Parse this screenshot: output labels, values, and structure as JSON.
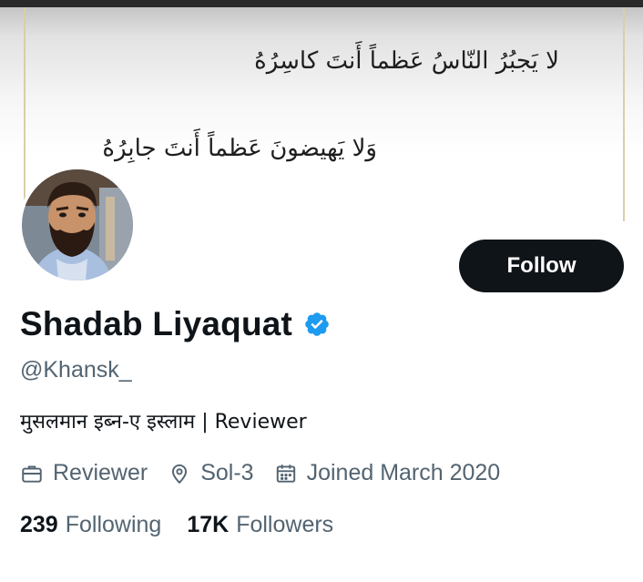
{
  "banner": {
    "verse_line_1": "لا يَجبُرُ النّاسُ عَظماً أَنتَ كاسِرُهُ",
    "verse_line_2": "وَلا يَهيضونَ عَظماً أَنتَ جابِرُهُ"
  },
  "profile": {
    "display_name": "Shadab Liyaquat",
    "handle": "@Khansk_",
    "bio": "मुसलमान इब्न-ए इस्लाम | Reviewer",
    "verified": true,
    "follow_label": "Follow"
  },
  "meta": {
    "profession": "Reviewer",
    "location": "Sol-3",
    "joined": "Joined March 2020"
  },
  "stats": {
    "following_count": "239",
    "following_label": "Following",
    "followers_count": "17K",
    "followers_label": "Followers"
  },
  "icons": {
    "verified": "verified-badge-icon",
    "profession": "briefcase-icon",
    "location": "location-pin-icon",
    "joined": "calendar-icon"
  },
  "colors": {
    "verified_blue": "#1d9bf0",
    "secondary_text": "#536471",
    "button_bg": "#0f1419"
  }
}
